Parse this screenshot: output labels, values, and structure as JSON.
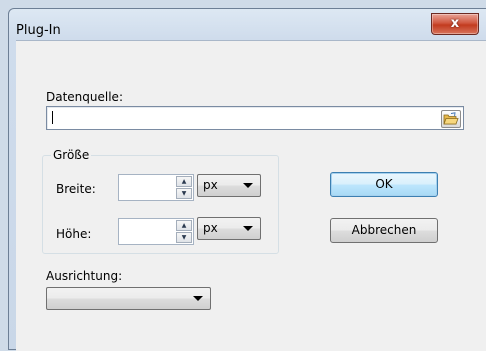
{
  "window": {
    "title": "Plug-In",
    "close_glyph": "x"
  },
  "source": {
    "label": "Datenquelle:",
    "value": "",
    "browse_icon": "folder-open-icon"
  },
  "size_group": {
    "title": "Größe",
    "width_label": "Breite:",
    "width_value": "",
    "width_unit": "px",
    "height_label": "Höhe:",
    "height_value": "",
    "height_unit": "px"
  },
  "buttons": {
    "ok_label": "OK",
    "cancel_label": "Abbrechen"
  },
  "alignment": {
    "label": "Ausrichtung:",
    "selected": ""
  },
  "colors": {
    "close_button": "#c23b1f",
    "default_button_border": "#3c7fb1",
    "client_background": "#f0f0f0"
  }
}
